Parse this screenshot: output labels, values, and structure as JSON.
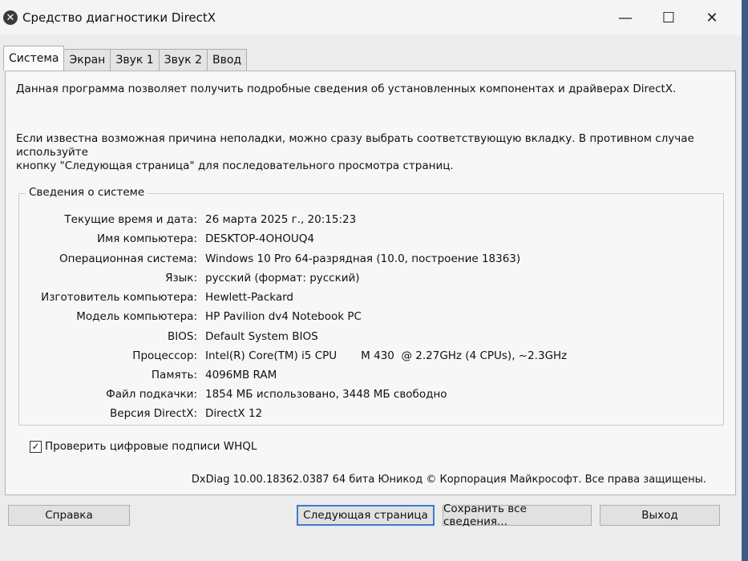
{
  "window": {
    "title": "Средство диагностики DirectX",
    "controls": {
      "minimize": "—",
      "maximize": "☐",
      "close": "✕"
    }
  },
  "tabs": [
    {
      "label": "Система",
      "active": true
    },
    {
      "label": "Экран",
      "active": false
    },
    {
      "label": "Звук 1",
      "active": false
    },
    {
      "label": "Звук 2",
      "active": false
    },
    {
      "label": "Ввод",
      "active": false
    }
  ],
  "panel": {
    "intro": "Данная программа позволяет получить подробные сведения об установленных компонентах и драйверах DirectX.",
    "hint_line1": "Если известна возможная причина неполадки, можно сразу выбрать соответствующую вкладку. В противном случае используйте",
    "hint_line2": "кнопку \"Следующая страница\" для последовательного просмотра страниц.",
    "system_info": {
      "title": "Сведения о системе",
      "rows": [
        {
          "label": "Текущие время и дата:",
          "value": "26 марта 2025 г., 20:15:23"
        },
        {
          "label": "Имя компьютера:",
          "value": "DESKTOP-4OHOUQ4"
        },
        {
          "label": "Операционная система:",
          "value": "Windows 10 Pro 64-разрядная (10.0, построение 18363)"
        },
        {
          "label": "Язык:",
          "value": "русский (формат: русский)"
        },
        {
          "label": "Изготовитель компьютера:",
          "value": "Hewlett-Packard"
        },
        {
          "label": "Модель компьютера:",
          "value": "HP Pavilion dv4 Notebook PC"
        },
        {
          "label": "BIOS:",
          "value": "Default System BIOS"
        },
        {
          "label": "Процессор:",
          "value": "Intel(R) Core(TM) i5 CPU       M 430  @ 2.27GHz (4 CPUs), ~2.3GHz"
        },
        {
          "label": "Память:",
          "value": "4096MB RAM"
        },
        {
          "label": "Файл подкачки:",
          "value": "1854 МБ использовано, 3448 МБ свободно"
        },
        {
          "label": "Версия DirectX:",
          "value": "DirectX 12"
        }
      ]
    },
    "whql": {
      "label": "Проверить цифровые подписи WHQL",
      "checked": true
    },
    "copyright": "DxDiag 10.00.18362.0387 64 бита Юникод © Корпорация Майкрософт. Все права защищены."
  },
  "buttons": {
    "help": "Справка",
    "next_page": "Следующая страница",
    "save_all": "Сохранить все сведения...",
    "exit": "Выход"
  }
}
